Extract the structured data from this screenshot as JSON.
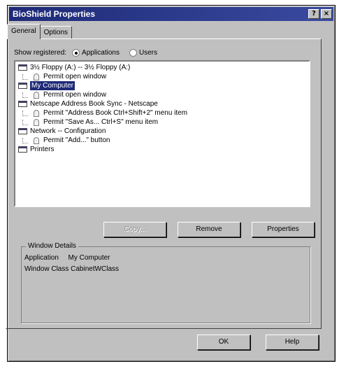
{
  "window": {
    "title": "BioShield Properties",
    "help_glyph": "?",
    "close_glyph": "×"
  },
  "tabs": [
    {
      "label": "General",
      "active": true
    },
    {
      "label": "Options",
      "active": false
    }
  ],
  "show_registered": {
    "label": "Show registered:",
    "options": [
      {
        "label": "Applications",
        "selected": true
      },
      {
        "label": "Users",
        "selected": false
      }
    ]
  },
  "tree": [
    {
      "label": "3½ Floppy (A:) -- 3½ Floppy (A:)",
      "level": 0,
      "icon": "window-icon",
      "selected": false
    },
    {
      "label": "Permit open window",
      "level": 1,
      "icon": "key-icon",
      "selected": false
    },
    {
      "label": "My Computer",
      "level": 0,
      "icon": "window-icon",
      "selected": true
    },
    {
      "label": "Permit open window",
      "level": 1,
      "icon": "key-icon",
      "selected": false
    },
    {
      "label": "Netscape Address Book Sync - Netscape",
      "level": 0,
      "icon": "window-icon",
      "selected": false
    },
    {
      "label": "Permit \"Address Book Ctrl+Shift+2\" menu item",
      "level": 1,
      "icon": "key-icon",
      "selected": false
    },
    {
      "label": "Permit \"Save As... Ctrl+S\" menu item",
      "level": 1,
      "icon": "key-icon",
      "selected": false
    },
    {
      "label": "Network -- Configuration",
      "level": 0,
      "icon": "window-icon",
      "selected": false
    },
    {
      "label": "Permit \"Add...\" button",
      "level": 1,
      "icon": "key-icon",
      "selected": false
    },
    {
      "label": "Printers",
      "level": 0,
      "icon": "window-icon",
      "selected": false
    }
  ],
  "buttons": {
    "copy": "Copy...",
    "remove": "Remove",
    "properties": "Properties",
    "ok": "OK",
    "help": "Help"
  },
  "window_details": {
    "title": "Window Details",
    "application_label": "Application",
    "application_value": "My Computer",
    "class_label": "Window Class",
    "class_value": "CabinetWClass"
  }
}
